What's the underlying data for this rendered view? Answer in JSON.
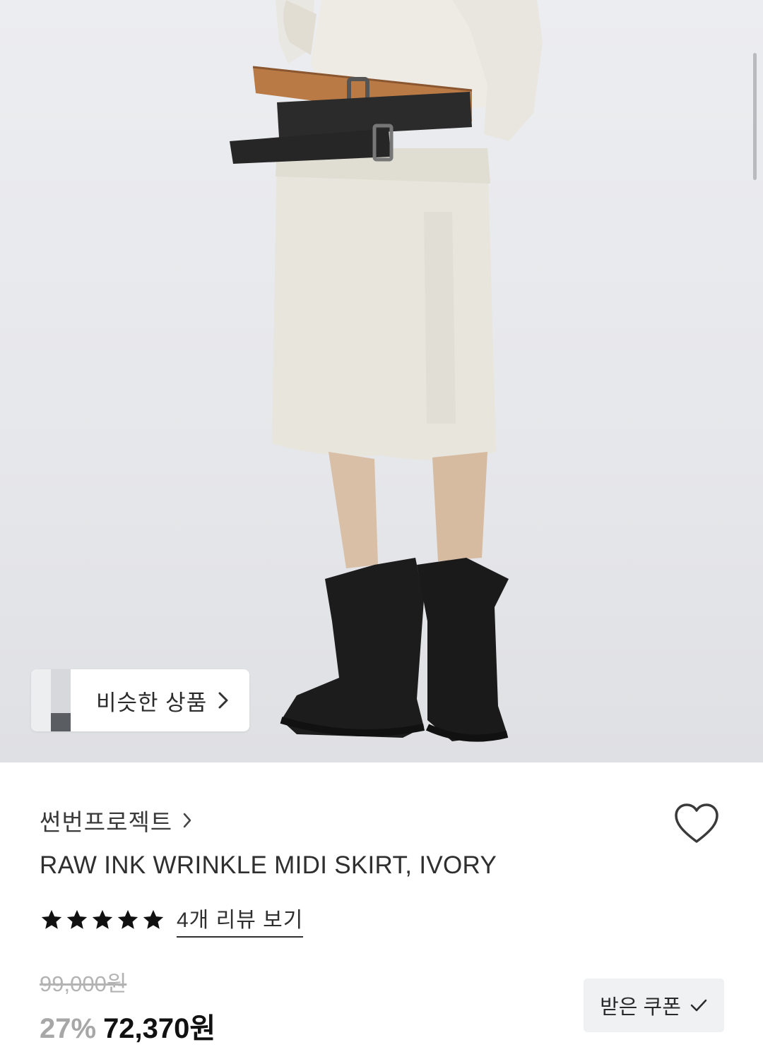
{
  "hero": {
    "image_alt": "Model wearing ivory wrinkle midi skirt with brown and black belts and black lace-up boots",
    "similar_chip": {
      "label": "비슷한 상품",
      "chevron_icon": "chevron-right-icon"
    }
  },
  "product": {
    "brand": "썬번프로젝트",
    "brand_chevron_icon": "chevron-right-icon",
    "title": "RAW INK WRINKLE MIDI SKIRT, IVORY",
    "wishlist_icon": "heart-outline-icon",
    "rating": {
      "stars": 5,
      "max": 5,
      "review_link": "4개 리뷰 보기"
    },
    "price": {
      "original": "99,000원",
      "discount": "27%",
      "sale": "72,370원"
    },
    "coupon": {
      "label": "받은 쿠폰",
      "icon": "check-icon"
    }
  },
  "colors": {
    "star": "#111111",
    "discount": "#a7a7a7",
    "original_price": "#b3b3b3"
  }
}
